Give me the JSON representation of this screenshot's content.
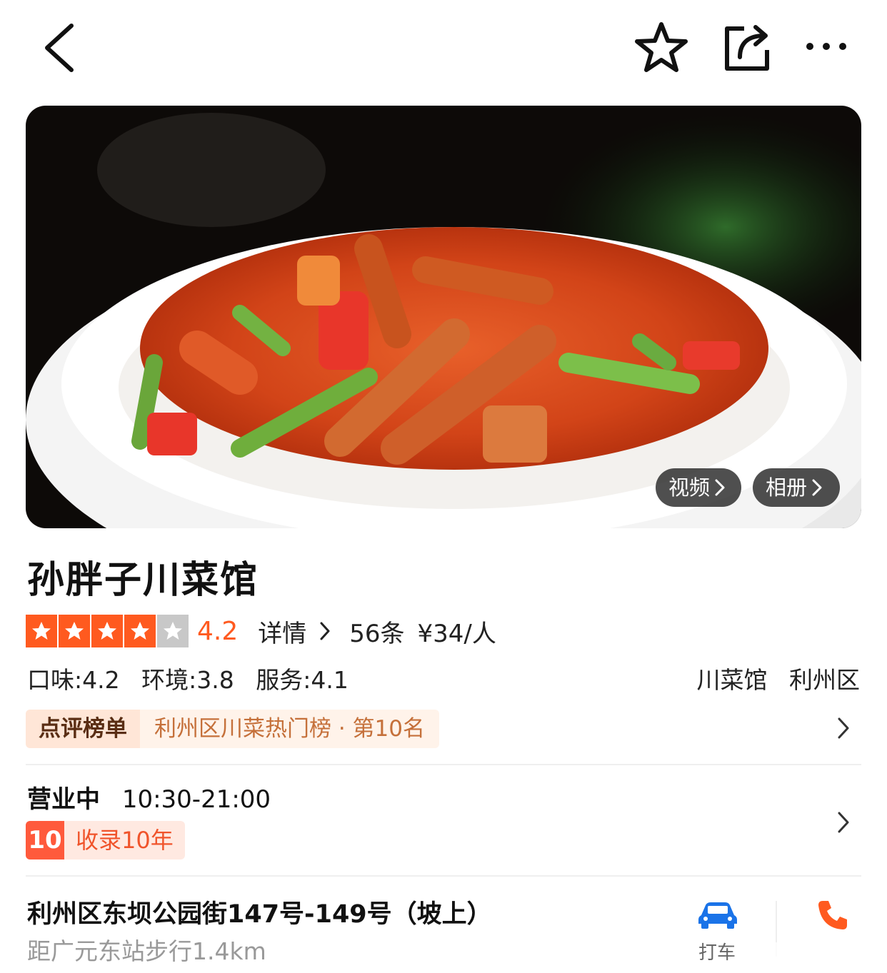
{
  "nav": {
    "back_icon": "chevron-left-icon",
    "favorite_icon": "star-outline-icon",
    "share_icon": "share-icon",
    "more_icon": "more-dots-icon"
  },
  "hero": {
    "video_label": "视频",
    "album_label": "相册"
  },
  "restaurant": {
    "name": "孙胖子川菜馆",
    "rating": "4.2",
    "stars_filled": 4,
    "stars_total": 5,
    "details_label": "详情",
    "review_count": "56条",
    "price": "¥34/人",
    "taste": "口味:4.2",
    "environment": "环境:3.8",
    "service": "服务:4.1",
    "category": "川菜馆",
    "district": "利州区"
  },
  "ranking": {
    "badge": "点评榜单",
    "text": "利州区川菜热门榜 · 第10名"
  },
  "hours": {
    "status": "营业中",
    "time": "10:30-21:00",
    "since_number": "10",
    "since_text": "收录10年"
  },
  "location": {
    "address": "利州区东坝公园街147号-149号（坡上）",
    "distance": "距广元东站步行1.4km",
    "taxi_label": "打车"
  },
  "colors": {
    "accent": "#ff5a1f",
    "taxi_blue": "#1a73e8",
    "phone_orange": "#ff5a1f"
  }
}
